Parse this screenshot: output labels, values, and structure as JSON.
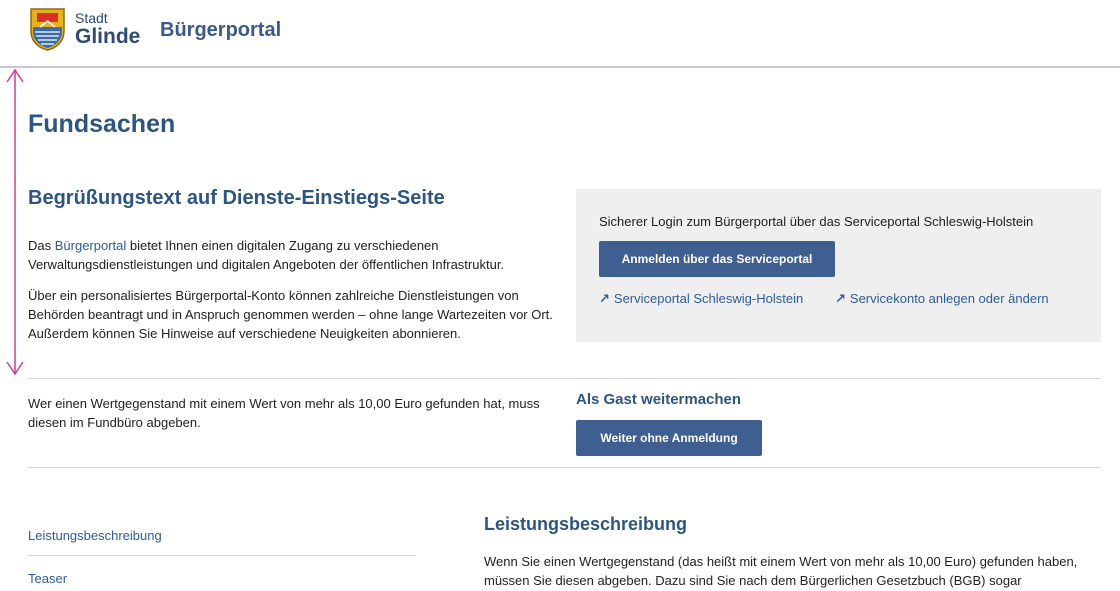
{
  "header": {
    "logo_small": "Stadt",
    "logo_big": "Glinde",
    "portal_title": "Bürgerportal",
    "logo_icon": "city-crest-icon"
  },
  "page": {
    "title": "Fundsachen",
    "welcome_heading": "Begrüßungstext auf Dienste-Einstiegs-Seite",
    "intro1_pre": "Das ",
    "intro1_link": "Bürgerportal",
    "intro1_post": " bietet Ihnen einen digitalen Zugang zu verschiedenen Verwaltungsdienstleistungen und digitalen Angeboten der öffentlichen Infrastruktur.",
    "intro2": "Über ein personalisiertes Bürgerportal-Konto können zahlreiche Dienstleistungen von Behörden beantragt und in Anspruch genommen werden – ohne lange Wartezeiten vor Ort. Außerdem können Sie Hinweise auf verschiedene Neuigkeiten abonnieren."
  },
  "login": {
    "text": "Sicherer Login zum Bürgerportal über das Serviceportal Schleswig-Holstein",
    "button": "Anmelden über das Serviceportal",
    "link1": "Serviceportal Schleswig-Holstein",
    "link2": "Servicekonto anlegen oder ändern"
  },
  "guest": {
    "found_text": "Wer einen Wertgegenstand mit einem Wert von mehr als 10,00 Euro gefunden hat, muss diesen im Fundbüro abgeben.",
    "title": "Als Gast weitermachen",
    "button": "Weiter ohne Anmeldung"
  },
  "sidebar": {
    "items": [
      "Leistungsbeschreibung",
      "Teaser"
    ]
  },
  "section": {
    "title": "Leistungsbeschreibung",
    "body": "Wenn Sie einen Wertgegenstand (das heißt mit einem Wert von mehr als 10,00 Euro) gefunden haben, müssen Sie diesen abgeben. Dazu sind Sie nach dem Bürgerlichen Gesetzbuch (BGB) sogar"
  },
  "colors": {
    "accent": "#3e5f8f",
    "heading": "#2e5580",
    "measure_line": "#d63a9a"
  }
}
